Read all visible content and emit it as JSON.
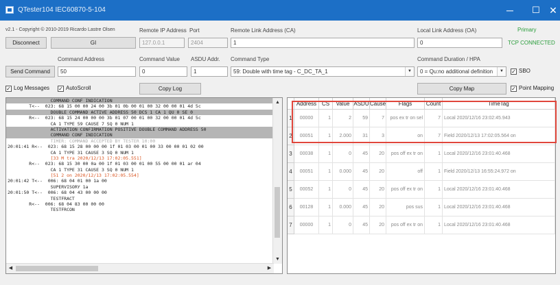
{
  "window": {
    "title": "QTester104 IEC60870-5-104",
    "min_glyph": "─",
    "max_glyph": "☐",
    "close_glyph": "✕"
  },
  "header": {
    "copyright": "v2.1 - Copyright © 2010-2019 Ricardo Lastre Olsen",
    "remote_ip_label": "Remote IP Address",
    "port_label": "Port",
    "remote_link_label": "Remote Link Address (CA)",
    "local_link_label": "Local Link Address (OA)",
    "primary": "Primary",
    "tcp_status": "TCP CONNECTED"
  },
  "connection": {
    "disconnect_label": "Disconnect",
    "gi_label": "GI",
    "remote_ip": "127.0.0.1",
    "port": "2404",
    "remote_link": "1",
    "local_link": "0"
  },
  "command": {
    "address_label": "Command Address",
    "value_label": "Command Value",
    "asdu_label": "ASDU Addr.",
    "type_label": "Command Type",
    "duration_label": "Command Duration / HPA",
    "send_label": "Send Command",
    "address": "50",
    "value": "0",
    "asdu": "1",
    "type": "59: Double with time tag - C_DC_TA_1",
    "duration": "0 = Qu:no additional definition",
    "sbo_label": "SBO"
  },
  "options": {
    "log_messages": "Log Messages",
    "autoscroll": "AutoScroll",
    "copy_log": "Copy Log",
    "copy_map": "Copy Map",
    "point_mapping": "Point Mapping"
  },
  "log_lines": [
    {
      "text": "                COMMAND CONF INDICATION",
      "style": "hl"
    },
    {
      "text": "        T<--  023: 68 15 00 00 24 00 3b 01 0b 00 01 00 32 00 00 01 4d 5c",
      "style": ""
    },
    {
      "text": "                DOUBLE COMMAND ACTIVE ADDRESS 50 DCS 1 CA 1 QU 0 SE 0",
      "style": "hl"
    },
    {
      "text": "        R<--  023: 68 15 24 00 00 00 3b 01 07 00 01 00 32 00 00 01 4d 5c",
      "style": ""
    },
    {
      "text": "                CA 1 TYPE 59 CAUSE 7 SQ 0 NUM 1",
      "style": ""
    },
    {
      "text": "                ACTIVATION CONFIRMATION POSITIVE DOUBLE COMMAND ADDRESS 50",
      "style": "hl"
    },
    {
      "text": "                COMMAND CONF INDICATION",
      "style": "hl"
    },
    {
      "text": "                TIMER: COMMAND ACCEPTED BY TESTER 10:00",
      "style": "gray"
    },
    {
      "text": "20:01:41 R<--  023: 68 15 28 00 00 00 1f 01 03 00 01 00 33 00 00 01 02 00",
      "style": ""
    },
    {
      "text": "                CA 1 TYPE 31 CAUSE 3 SQ 0 NUM 1",
      "style": ""
    },
    {
      "text": "                [33 M tra 2020/12/13 17:02:05.551]",
      "style": "red"
    },
    {
      "text": "        R<--  023: 68 15 30 00 0a 00 1f 01 03 00 01 00 55 00 00 01 ar 04",
      "style": ""
    },
    {
      "text": "                CA 1 TYPE 31 CAUSE 3 SQ 0 NUM 1",
      "style": ""
    },
    {
      "text": "                [51 2 on 2020/12/13 17:02:05.554]",
      "style": "red"
    },
    {
      "text": "20:01:42 T<--  006: 68 04 01 00 1a 00",
      "style": ""
    },
    {
      "text": "                SUPERVISORY 1a",
      "style": ""
    },
    {
      "text": "20:01:50 T<--  006: 68 04 43 00 00 00",
      "style": ""
    },
    {
      "text": "                TESTFRACT",
      "style": ""
    },
    {
      "text": "        R<--  006: 68 04 83 00 00 00",
      "style": ""
    },
    {
      "text": "                TESTFRCON",
      "style": ""
    }
  ],
  "table": {
    "headers": [
      "Address",
      "CS",
      "Value",
      "ASDU",
      "Cause",
      "Flags",
      "Count",
      "TimeTag"
    ],
    "rows": [
      {
        "num": "1",
        "address": "00000",
        "cs": "1",
        "value": "2",
        "asdu": "59",
        "cause": "7",
        "flags": "pos ex tr on sel",
        "count": "7",
        "timetag": "Local 2020/12/16 23:02:45.943"
      },
      {
        "num": "2",
        "address": "00051",
        "cs": "1",
        "value": "2.000",
        "asdu": "31",
        "cause": "3",
        "flags": "on",
        "count": "7",
        "timetag": "Field 2020/12/13 17:02:05.564 on"
      },
      {
        "num": "3",
        "address": "00038",
        "cs": "1",
        "value": "0",
        "asdu": "45",
        "cause": "20",
        "flags": "pos off ex tr on",
        "count": "1",
        "timetag": "Local 2020/12/16 23:01:40.468"
      },
      {
        "num": "4",
        "address": "00051",
        "cs": "1",
        "value": "0.000",
        "asdu": "45",
        "cause": "20",
        "flags": "off",
        "count": "1",
        "timetag": "Field 2020/12/13 16:55:24.972 on"
      },
      {
        "num": "5",
        "address": "00052",
        "cs": "1",
        "value": "0",
        "asdu": "45",
        "cause": "20",
        "flags": "pos off ex tr on",
        "count": "1",
        "timetag": "Local 2020/12/16 23:01:40.468"
      },
      {
        "num": "6",
        "address": "00128",
        "cs": "1",
        "value": "0.000",
        "asdu": "45",
        "cause": "20",
        "flags": "pos sus",
        "count": "1",
        "timetag": "Local 2020/12/16 23:01:40.468"
      },
      {
        "num": "7",
        "address": "00000",
        "cs": "1",
        "value": "0",
        "asdu": "45",
        "cause": "20",
        "flags": "pos off ex tr on",
        "count": "1",
        "timetag": "Local 2020/12/16 23:01:40.468"
      }
    ]
  }
}
